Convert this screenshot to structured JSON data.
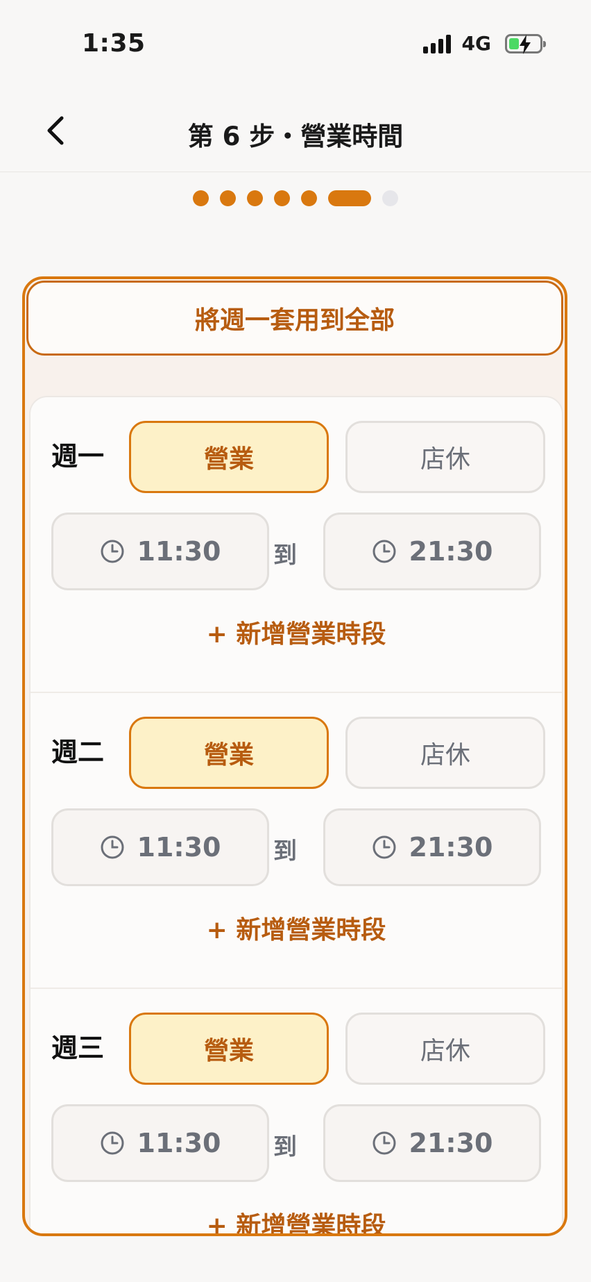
{
  "status": {
    "time": "1:35",
    "network": "4G"
  },
  "header": {
    "title": "第 6 步・營業時間"
  },
  "steps": {
    "total": 7,
    "current": 6
  },
  "apply_all_label": "將週一套用到全部",
  "days": [
    {
      "label": "週一",
      "open_label": "營業",
      "closed_label": "店休",
      "start": "11:30",
      "to": "到",
      "end": "21:30",
      "add_slot": "+ 新增營業時段",
      "state": "open"
    },
    {
      "label": "週二",
      "open_label": "營業",
      "closed_label": "店休",
      "start": "11:30",
      "to": "到",
      "end": "21:30",
      "add_slot": "+ 新增營業時段",
      "state": "open"
    },
    {
      "label": "週三",
      "open_label": "營業",
      "closed_label": "店休",
      "start": "11:30",
      "to": "到",
      "end": "21:30",
      "add_slot": "+ 新增營業時段",
      "state": "open"
    }
  ],
  "colors": {
    "accent": "#d9780f",
    "accent_text": "#b75c10",
    "open_bg": "#fdf1c8",
    "muted_text": "#6b6f78"
  }
}
